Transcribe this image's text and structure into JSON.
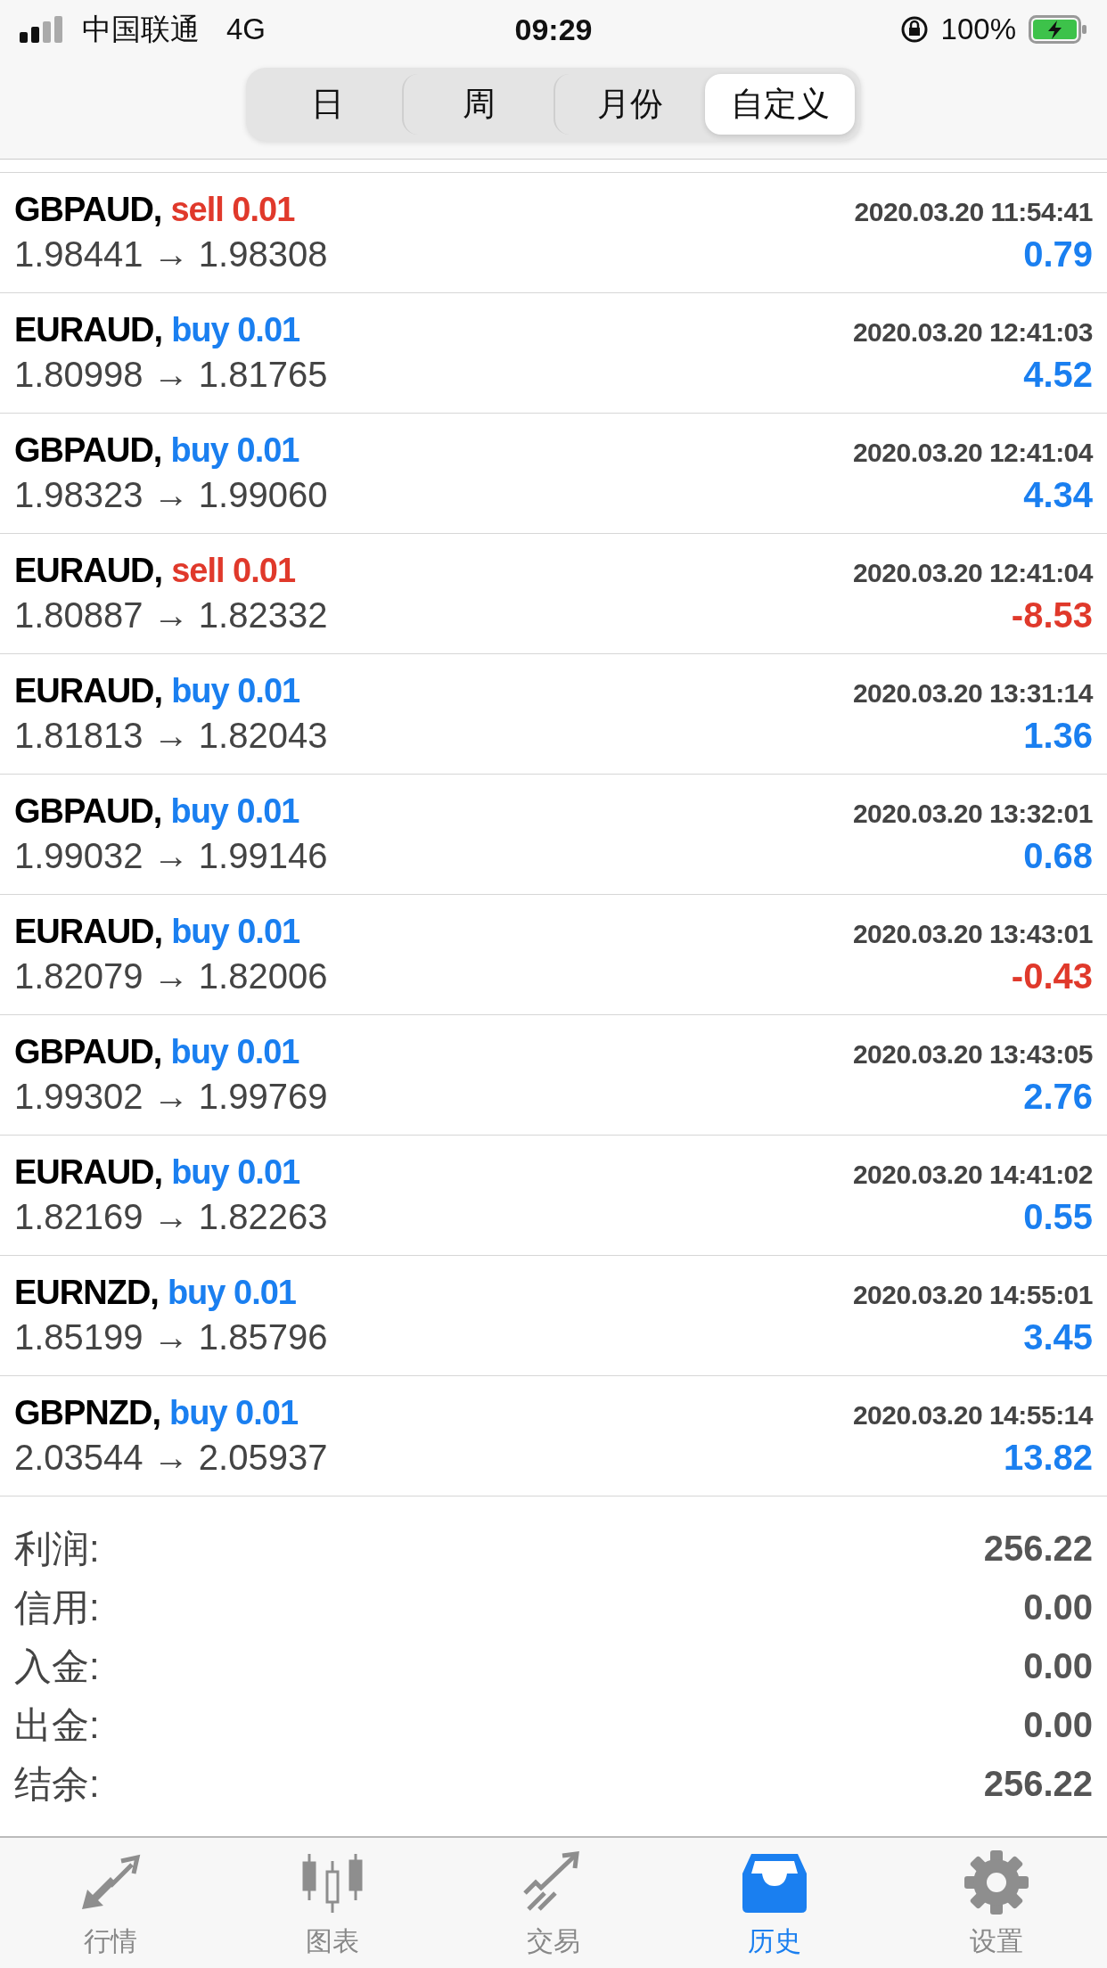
{
  "status_bar": {
    "carrier": "中国联通",
    "network": "4G",
    "time": "09:29",
    "battery": "100%"
  },
  "period_tabs": [
    {
      "label": "日",
      "selected": false
    },
    {
      "label": "周",
      "selected": false
    },
    {
      "label": "月份",
      "selected": false
    },
    {
      "label": "自定义",
      "selected": true
    }
  ],
  "deals": [
    {
      "symbol": "GBPAUD,",
      "side": {
        "text": "sell 0.01",
        "kind": "sell"
      },
      "time": "2020.03.20 11:54:41",
      "prices": "1.98441 → 1.98308",
      "profit": "0.79",
      "loss": false
    },
    {
      "symbol": "EURAUD,",
      "side": {
        "text": "buy 0.01",
        "kind": "buy"
      },
      "time": "2020.03.20 12:41:03",
      "prices": "1.80998 → 1.81765",
      "profit": "4.52",
      "loss": false
    },
    {
      "symbol": "GBPAUD,",
      "side": {
        "text": "buy 0.01",
        "kind": "buy"
      },
      "time": "2020.03.20 12:41:04",
      "prices": "1.98323 → 1.99060",
      "profit": "4.34",
      "loss": false
    },
    {
      "symbol": "EURAUD,",
      "side": {
        "text": "sell 0.01",
        "kind": "sell"
      },
      "time": "2020.03.20 12:41:04",
      "prices": "1.80887 → 1.82332",
      "profit": "-8.53",
      "loss": true
    },
    {
      "symbol": "EURAUD,",
      "side": {
        "text": "buy 0.01",
        "kind": "buy"
      },
      "time": "2020.03.20 13:31:14",
      "prices": "1.81813 → 1.82043",
      "profit": "1.36",
      "loss": false
    },
    {
      "symbol": "GBPAUD,",
      "side": {
        "text": "buy 0.01",
        "kind": "buy"
      },
      "time": "2020.03.20 13:32:01",
      "prices": "1.99032 → 1.99146",
      "profit": "0.68",
      "loss": false
    },
    {
      "symbol": "EURAUD,",
      "side": {
        "text": "buy 0.01",
        "kind": "buy"
      },
      "time": "2020.03.20 13:43:01",
      "prices": "1.82079 → 1.82006",
      "profit": "-0.43",
      "loss": true
    },
    {
      "symbol": "GBPAUD,",
      "side": {
        "text": "buy 0.01",
        "kind": "buy"
      },
      "time": "2020.03.20 13:43:05",
      "prices": "1.99302 → 1.99769",
      "profit": "2.76",
      "loss": false
    },
    {
      "symbol": "EURAUD,",
      "side": {
        "text": "buy 0.01",
        "kind": "buy"
      },
      "time": "2020.03.20 14:41:02",
      "prices": "1.82169 → 1.82263",
      "profit": "0.55",
      "loss": false
    },
    {
      "symbol": "EURNZD,",
      "side": {
        "text": "buy 0.01",
        "kind": "buy"
      },
      "time": "2020.03.20 14:55:01",
      "prices": "1.85199 → 1.85796",
      "profit": "3.45",
      "loss": false
    },
    {
      "symbol": "GBPNZD,",
      "side": {
        "text": "buy 0.01",
        "kind": "buy"
      },
      "time": "2020.03.20 14:55:14",
      "prices": "2.03544 → 2.05937",
      "profit": "13.82",
      "loss": false
    }
  ],
  "summary": [
    {
      "label": "利润:",
      "value": "256.22"
    },
    {
      "label": "信用:",
      "value": "0.00"
    },
    {
      "label": "入金:",
      "value": "0.00"
    },
    {
      "label": "出金:",
      "value": "0.00"
    },
    {
      "label": "结余:",
      "value": "256.22"
    }
  ],
  "tab_bar": [
    {
      "label": "行情",
      "kind": "quotes",
      "selected": false
    },
    {
      "label": "图表",
      "kind": "chart",
      "selected": false
    },
    {
      "label": "交易",
      "kind": "trade",
      "selected": false
    },
    {
      "label": "历史",
      "kind": "history",
      "selected": true
    },
    {
      "label": "设置",
      "kind": "settings",
      "selected": false
    }
  ]
}
